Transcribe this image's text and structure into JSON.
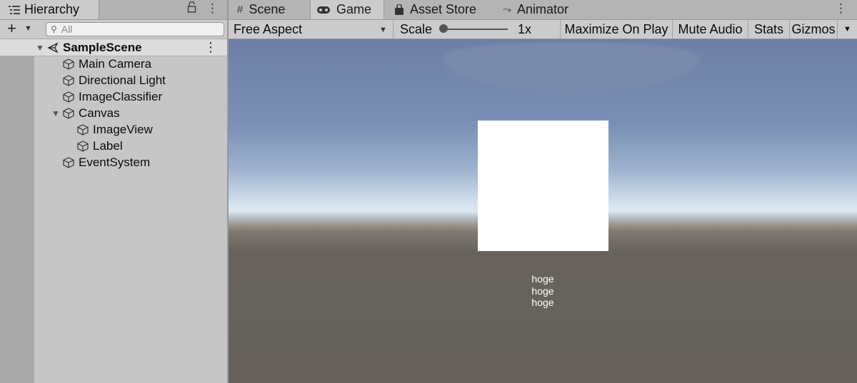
{
  "hierarchy": {
    "tab_label": "Hierarchy",
    "search_placeholder": "All",
    "scene_name": "SampleScene",
    "items": [
      {
        "label": "Main Camera"
      },
      {
        "label": "Directional Light"
      },
      {
        "label": "ImageClassifier"
      },
      {
        "label": "Canvas",
        "expanded": true
      },
      {
        "label": "ImageView"
      },
      {
        "label": "Label"
      },
      {
        "label": "EventSystem"
      }
    ]
  },
  "main_tabs": [
    {
      "label": "Scene",
      "icon": "grid-icon"
    },
    {
      "label": "Game",
      "icon": "gamepad-icon",
      "active": true
    },
    {
      "label": "Asset Store",
      "icon": "bag-icon"
    },
    {
      "label": "Animator",
      "icon": "animator-icon"
    }
  ],
  "game_toolbar": {
    "aspect": "Free Aspect",
    "scale_label": "Scale",
    "scale_value": "1x",
    "maximize_on_play": "Maximize On Play",
    "mute_audio": "Mute Audio",
    "stats": "Stats",
    "gizmos": "Gizmos"
  },
  "game_view": {
    "label_lines": [
      "hoge",
      "hoge",
      "hoge"
    ]
  }
}
